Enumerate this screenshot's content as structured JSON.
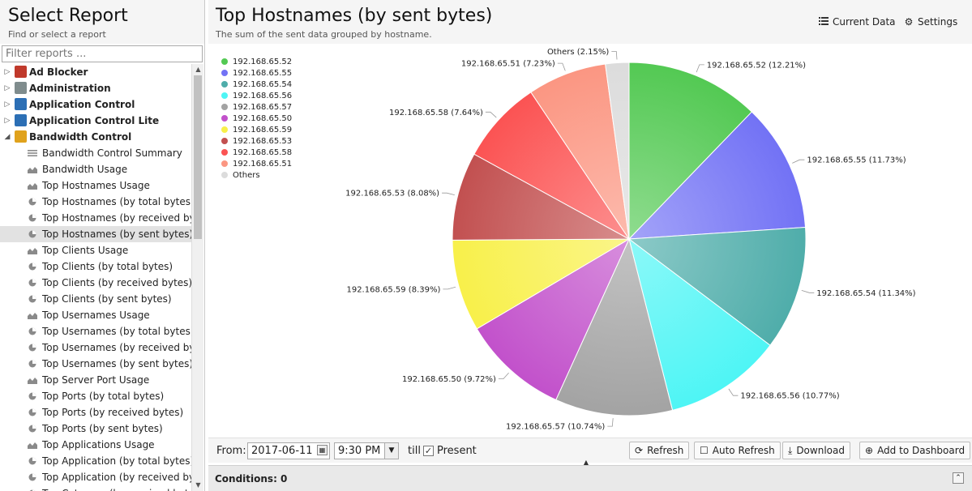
{
  "left_panel": {
    "title": "Select Report",
    "subtitle": "Find or select a report",
    "filter_placeholder": "Filter reports ..."
  },
  "tree": [
    {
      "type": "category",
      "label": "Ad Blocker",
      "expander": "▷",
      "icon": "ad-blocker-icon",
      "color": "#c0392b"
    },
    {
      "type": "category",
      "label": "Administration",
      "expander": "▷",
      "icon": "administration-icon",
      "color": "#7f8c8d"
    },
    {
      "type": "category",
      "label": "Application Control",
      "expander": "▷",
      "icon": "application-control-icon",
      "color": "#2c6fb5"
    },
    {
      "type": "category",
      "label": "Application Control Lite",
      "expander": "▷",
      "icon": "application-control-lite-icon",
      "color": "#2c6fb5"
    },
    {
      "type": "category",
      "label": "Bandwidth Control",
      "expander": "◢",
      "icon": "bandwidth-control-icon",
      "color": "#e0a21c"
    },
    {
      "type": "leaf",
      "label": "Bandwidth Control Summary",
      "icon": "text-report-icon"
    },
    {
      "type": "leaf",
      "label": "Bandwidth Usage",
      "icon": "area-chart-icon"
    },
    {
      "type": "leaf",
      "label": "Top Hostnames Usage",
      "icon": "area-chart-icon"
    },
    {
      "type": "leaf",
      "label": "Top Hostnames (by total bytes)",
      "icon": "pie-chart-icon"
    },
    {
      "type": "leaf",
      "label": "Top Hostnames (by received byte...",
      "icon": "pie-chart-icon"
    },
    {
      "type": "leaf",
      "label": "Top Hostnames (by sent bytes)",
      "icon": "pie-chart-icon",
      "selected": true
    },
    {
      "type": "leaf",
      "label": "Top Clients Usage",
      "icon": "area-chart-icon"
    },
    {
      "type": "leaf",
      "label": "Top Clients (by total bytes)",
      "icon": "pie-chart-icon"
    },
    {
      "type": "leaf",
      "label": "Top Clients (by received bytes)",
      "icon": "pie-chart-icon"
    },
    {
      "type": "leaf",
      "label": "Top Clients (by sent bytes)",
      "icon": "pie-chart-icon"
    },
    {
      "type": "leaf",
      "label": "Top Usernames Usage",
      "icon": "area-chart-icon"
    },
    {
      "type": "leaf",
      "label": "Top Usernames (by total bytes)",
      "icon": "pie-chart-icon"
    },
    {
      "type": "leaf",
      "label": "Top Usernames (by received bytes)",
      "icon": "pie-chart-icon"
    },
    {
      "type": "leaf",
      "label": "Top Usernames (by sent bytes)",
      "icon": "pie-chart-icon"
    },
    {
      "type": "leaf",
      "label": "Top Server Port Usage",
      "icon": "area-chart-icon"
    },
    {
      "type": "leaf",
      "label": "Top Ports (by total bytes)",
      "icon": "pie-chart-icon"
    },
    {
      "type": "leaf",
      "label": "Top Ports (by received bytes)",
      "icon": "pie-chart-icon"
    },
    {
      "type": "leaf",
      "label": "Top Ports (by sent bytes)",
      "icon": "pie-chart-icon"
    },
    {
      "type": "leaf",
      "label": "Top Applications Usage",
      "icon": "area-chart-icon"
    },
    {
      "type": "leaf",
      "label": "Top Application (by total bytes)",
      "icon": "pie-chart-icon"
    },
    {
      "type": "leaf",
      "label": "Top Application (by received bytes)",
      "icon": "pie-chart-icon"
    },
    {
      "type": "leaf",
      "label": "Top Category (by received bytes)",
      "icon": "pie-chart-icon"
    }
  ],
  "header": {
    "title": "Top Hostnames (by sent bytes)",
    "subtitle": "The sum of the sent data grouped by hostname.",
    "current_data_label": "Current Data",
    "settings_label": "Settings"
  },
  "chart_data": {
    "type": "pie",
    "legend_position": "top-left",
    "slices": [
      {
        "name": "192.168.65.52",
        "label": "192.168.65.52 (12.21%)",
        "value": 12.21,
        "color": "#53c953"
      },
      {
        "name": "192.168.65.55",
        "label": "192.168.65.55 (11.73%)",
        "value": 11.73,
        "color": "#7272f5"
      },
      {
        "name": "192.168.65.54",
        "label": "192.168.65.54 (11.34%)",
        "value": 11.34,
        "color": "#4fadaa"
      },
      {
        "name": "192.168.65.56",
        "label": "192.168.65.56 (10.77%)",
        "value": 10.77,
        "color": "#4ef5f5"
      },
      {
        "name": "192.168.65.57",
        "label": "192.168.65.57 (10.74%)",
        "value": 10.74,
        "color": "#a3a3a3"
      },
      {
        "name": "192.168.65.50",
        "label": "192.168.65.50 (9.72%)",
        "value": 9.72,
        "color": "#c251cb"
      },
      {
        "name": "192.168.65.59",
        "label": "192.168.65.59 (8.39%)",
        "value": 8.39,
        "color": "#f8f04a"
      },
      {
        "name": "192.168.65.53",
        "label": "192.168.65.53 (8.08%)",
        "value": 8.08,
        "color": "#c25050"
      },
      {
        "name": "192.168.65.58",
        "label": "192.168.65.58 (7.64%)",
        "value": 7.64,
        "color": "#fb5353"
      },
      {
        "name": "192.168.65.51",
        "label": "192.168.65.51 (7.23%)",
        "value": 7.23,
        "color": "#fb9682"
      },
      {
        "name": "Others",
        "label": "Others (2.15%)",
        "value": 2.15,
        "color": "#dcdcdc"
      }
    ]
  },
  "toolbar": {
    "from_label": "From:",
    "date_value": "2017-06-11",
    "time_value": "9:30 PM",
    "till_label": "till",
    "present_label": "Present",
    "present_checked": true,
    "refresh_label": "Refresh",
    "auto_refresh_label": "Auto Refresh",
    "download_label": "Download",
    "add_dashboard_label": "Add to Dashboard"
  },
  "conditions": {
    "label": "Conditions: 0"
  }
}
